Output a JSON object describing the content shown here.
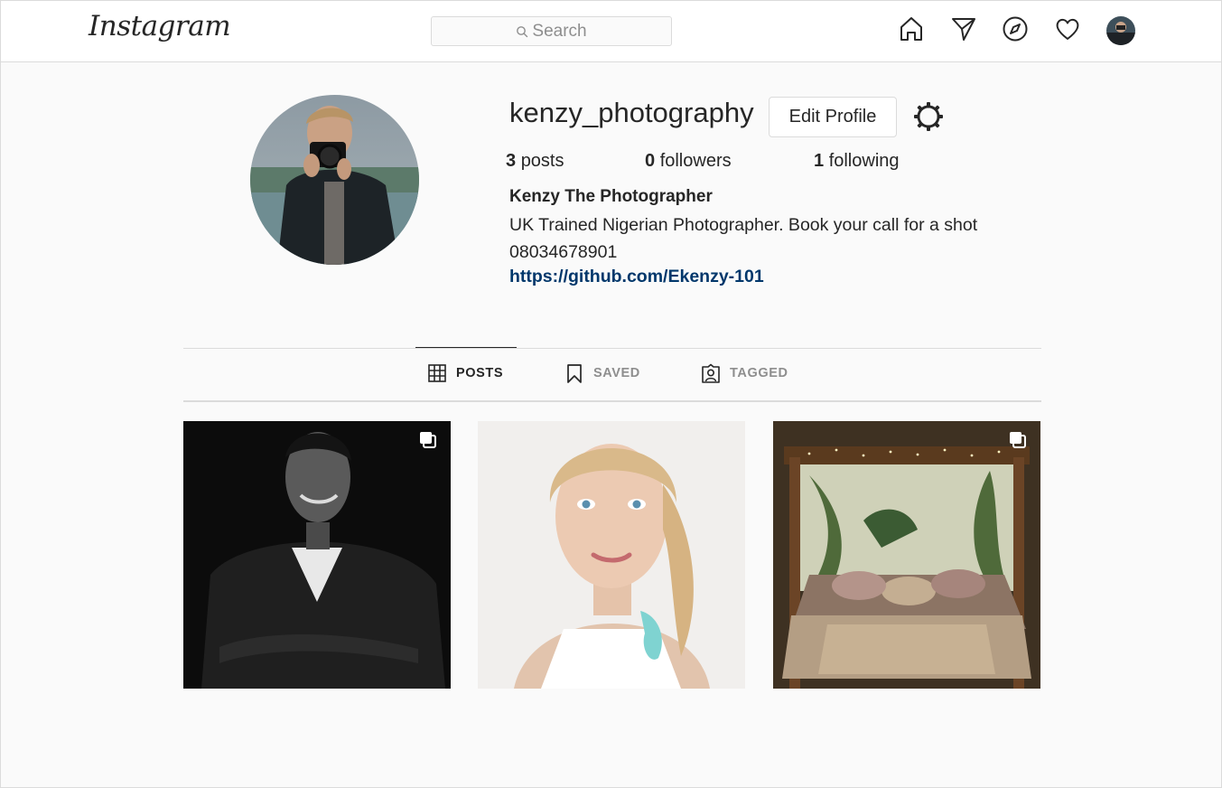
{
  "nav": {
    "logo": "Instagram",
    "search_placeholder": "Search",
    "icons": [
      "home-icon",
      "direct-message-icon",
      "explore-icon",
      "activity-heart-icon",
      "profile-avatar"
    ]
  },
  "profile": {
    "username": "kenzy_photography",
    "edit_button": "Edit Profile",
    "stats": {
      "posts_count": "3",
      "posts_label": "posts",
      "followers_count": "0",
      "followers_label": "followers",
      "following_count": "1",
      "following_label": "following"
    },
    "full_name": "Kenzy The Photographer",
    "bio": "UK Trained Nigerian Photographer. Book your call for a shot 08034678901",
    "link": "https://github.com/Ekenzy-101"
  },
  "tabs": [
    {
      "label": "POSTS",
      "icon": "grid-icon",
      "active": true
    },
    {
      "label": "SAVED",
      "icon": "bookmark-icon",
      "active": false
    },
    {
      "label": "TAGGED",
      "icon": "tagged-user-icon",
      "active": false
    }
  ],
  "posts": [
    {
      "subject": "man-portrait-bw",
      "multiple": true
    },
    {
      "subject": "woman-portrait",
      "multiple": false
    },
    {
      "subject": "bed-interior",
      "multiple": true
    }
  ],
  "colors": {
    "link": "#00376b",
    "border": "#dbdbdb",
    "background": "#fafafa",
    "muted_text": "#8e8e8e"
  }
}
